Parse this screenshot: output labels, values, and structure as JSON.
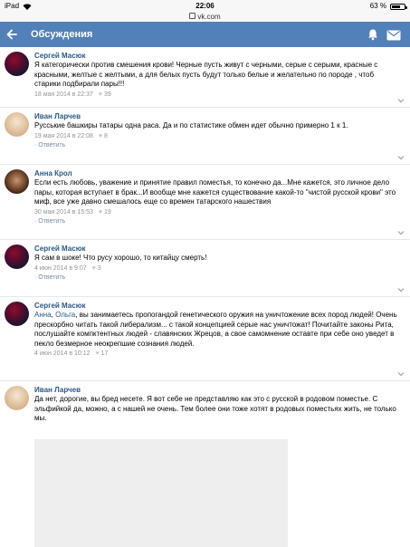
{
  "statusbar": {
    "device": "iPad",
    "time": "22:06",
    "battery": "63 %",
    "url": "vk.com"
  },
  "header": {
    "title": "Обсуждения"
  },
  "comments": [
    {
      "author": "Сергей Масюк",
      "avatar": "masyuk",
      "text": "Я категорически против смешения крови! Черные пусть живут с черными, серые с серыми, красные с красными, желтые с желтыми, а для белых пусть будут только белые и желательно по породе , чтоб старики подбирали пары!!!",
      "date": "18 мая 2014 в 22:37",
      "likes": "39",
      "reply": ""
    },
    {
      "author": "Иван Ларчев",
      "avatar": "larchev",
      "text": "Русськие башкиры татары одна раса. Да и по статистике обмен идет обычно примерно 1 к 1.",
      "date": "19 мая 2014 в 22:08",
      "likes": "8",
      "reply": ""
    },
    {
      "author": "Анна Крол",
      "avatar": "krol",
      "text": "Если есть любовь, уважение и принятие правил поместья, то конечно да...Мне кажется, это личное дело пары, которая вступает в брак...И вообще мне кажется существование какой-то \"чистой русской крови\" это миф, все уже давно смешалось еще со времен татарского нашествия",
      "date": "30 мая 2014 в 15:53",
      "likes": "19",
      "reply": ""
    },
    {
      "author": "Сергей Масюк",
      "avatar": "masyuk",
      "text": "Я сам в шоке! Что русу хорошо, то китайцу смерть!",
      "date": "4 июн 2014 в 9:07",
      "likes": "3",
      "reply": ""
    },
    {
      "author": "Сергей Масюк",
      "avatar": "masyuk",
      "mention1": "Анна",
      "mention2": "Ольга",
      "text": ", вы занимаетесь пропогандой генетического оружия на уничтожение всех пород людей! Очень прескорбно читать такой либерализм... с такой концепцией серые нас уничтожат! Почитайте законы Рита, послушайте компктентных людей - славянских Жрецов, а свое самомнение оставте при себе оно уведет в пекло безмерное неокрепшие сознания людей.",
      "date": "4 июн 2014 в 10:12",
      "likes": "17",
      "reply": ""
    },
    {
      "author": "Иван Ларчев",
      "avatar": "larchev",
      "text": "Да нет, дорогие, вы бред несете. Я вот себе не представляю как это с русской в родовом поместье. С эльфийкой да, можно, а с нашей не очень. Тем более они тоже хотят в родовых поместьях жить, не только мы.",
      "date": "",
      "likes": "",
      "reply": ""
    }
  ],
  "labels": {
    "reply": "Ответить",
    "sep": "·",
    "comma": ","
  }
}
